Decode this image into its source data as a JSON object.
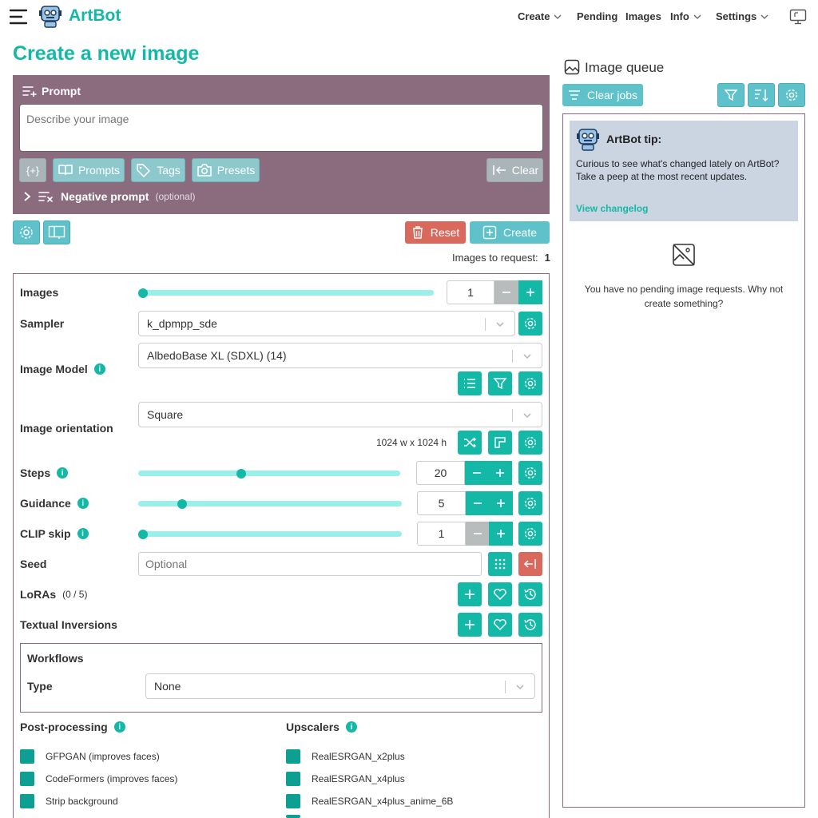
{
  "header": {
    "app_name": "ArtBot",
    "nav": [
      {
        "label": "Create",
        "has_dropdown": true
      },
      {
        "label": "Pending",
        "has_dropdown": false
      },
      {
        "label": "Images",
        "has_dropdown": false
      },
      {
        "label": "Info",
        "has_dropdown": true
      },
      {
        "label": "Settings",
        "has_dropdown": true
      }
    ]
  },
  "page_title": "Create a new image",
  "prompt": {
    "label": "Prompt",
    "placeholder": "Describe your image",
    "value": "",
    "buttons": {
      "style_icon": "{+}",
      "prompts": "Prompts",
      "tags": "Tags",
      "presets": "Presets",
      "clear": "Clear"
    },
    "negative_label": "Negative prompt",
    "negative_optional": "(optional)"
  },
  "actions": {
    "reset": "Reset",
    "create": "Create",
    "images_to_request_label": "Images to request:",
    "images_to_request_value": "1"
  },
  "settings": {
    "images": {
      "label": "Images",
      "value": "1",
      "slider_fraction": 0.0
    },
    "sampler": {
      "label": "Sampler",
      "value": "k_dpmpp_sde"
    },
    "image_model": {
      "label": "Image Model",
      "value": "AlbedoBase XL (SDXL) (14)"
    },
    "orientation": {
      "label": "Image orientation",
      "value": "Square",
      "dimensions": "1024 w x 1024 h"
    },
    "steps": {
      "label": "Steps",
      "value": "20",
      "slider_fraction": 0.39
    },
    "guidance": {
      "label": "Guidance",
      "value": "5",
      "slider_fraction": 0.17
    },
    "clip_skip": {
      "label": "CLIP skip",
      "value": "1",
      "slider_fraction": 0.0
    },
    "seed": {
      "label": "Seed",
      "placeholder": "Optional"
    },
    "loras": {
      "label": "LoRAs",
      "count": "(0 / 5)"
    },
    "textual_inversions": {
      "label": "Textual Inversions"
    },
    "workflows": {
      "title": "Workflows",
      "type_label": "Type",
      "type_value": "None"
    },
    "post_processing": {
      "label": "Post-processing",
      "items": [
        "GFPGAN (improves faces)",
        "CodeFormers (improves faces)",
        "Strip background"
      ]
    },
    "upscalers": {
      "label": "Upscalers",
      "items": [
        "RealESRGAN_x2plus",
        "RealESRGAN_x4plus",
        "RealESRGAN_x4plus_anime_6B"
      ]
    }
  },
  "queue": {
    "title": "Image queue",
    "clear_jobs": "Clear jobs",
    "tip": {
      "title": "ArtBot tip:",
      "text": "Curious to see what's changed lately on ArtBot? Take a peep at the most recent updates.",
      "link": "View changelog"
    },
    "empty_message": "You have no pending image requests. Why not create something?"
  },
  "colors": {
    "accent": "#14b8a6",
    "prompt_panel": "#8a6c7e",
    "button_light": "#5fc1c9",
    "danger": "#d9695d",
    "tip_bg": "#cbd5e1"
  }
}
